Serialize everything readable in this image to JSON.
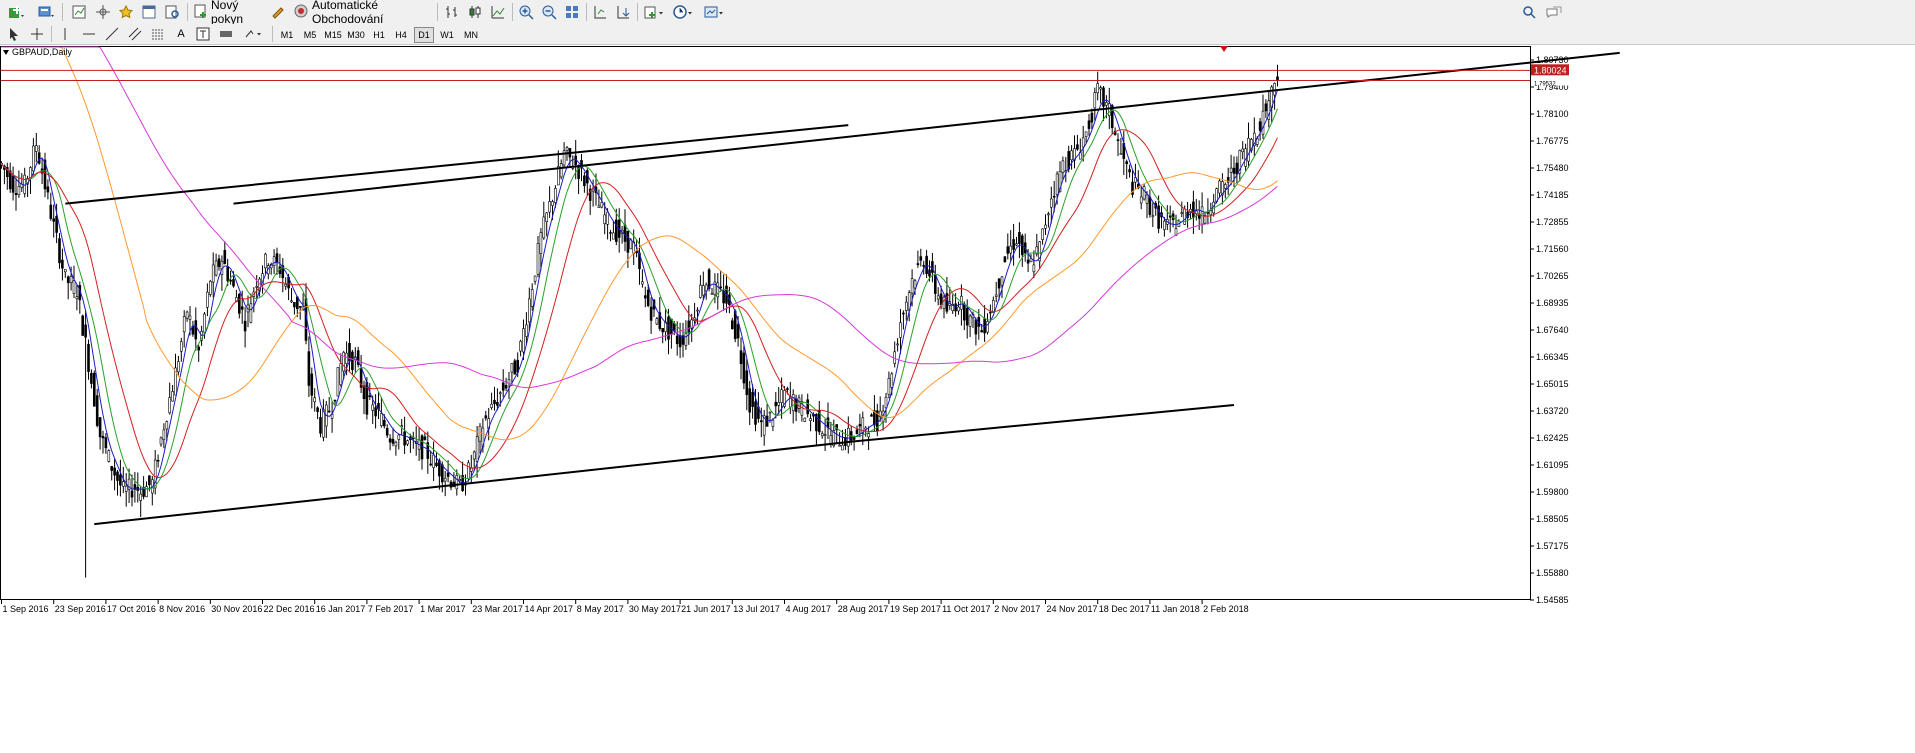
{
  "toolbar": {
    "new_order_label": "Nový pokyn",
    "auto_trading_label": "Automatické Obchodování",
    "icons": [
      "new-chart-icon",
      "profiles-icon",
      "market-watch-icon",
      "navigator-icon",
      "favorites-icon",
      "terminal-icon",
      "strategy-tester-icon",
      "new-order-icon",
      "metaeditor-icon",
      "auto-trading-icon",
      "bar-chart-icon",
      "candlestick-icon",
      "line-chart-icon",
      "zoom-in-icon",
      "zoom-out-icon",
      "tile-windows-icon",
      "chart-shift-icon",
      "autoscroll-icon",
      "indicators-icon",
      "periods-icon",
      "templates-icon",
      "search-icon",
      "chat-icon"
    ]
  },
  "timeframes": [
    "M1",
    "M5",
    "M15",
    "M30",
    "H1",
    "H4",
    "D1",
    "W1",
    "MN"
  ],
  "active_timeframe": "D1",
  "chart_data": {
    "type": "candlestick",
    "title": "GBPAUD,Daily",
    "symbol": "GBPAUD",
    "period": "Daily",
    "price_ticks": [
      "1.80730",
      "1.79400",
      "1.78100",
      "1.76775",
      "1.75480",
      "1.74185",
      "1.72855",
      "1.71560",
      "1.70265",
      "1.68935",
      "1.67640",
      "1.66345",
      "1.65015",
      "1.63720",
      "1.62425",
      "1.61095",
      "1.59800",
      "1.58505",
      "1.57175",
      "1.55880",
      "1.54585"
    ],
    "ylim": [
      1.54585,
      1.8114
    ],
    "date_ticks": [
      "1 Sep 2016",
      "23 Sep 2016",
      "17 Oct 2016",
      "8 Nov 2016",
      "30 Nov 2016",
      "22 Dec 2016",
      "16 Jan 2017",
      "7 Feb 2017",
      "1 Mar 2017",
      "23 Mar 2017",
      "14 Apr 2017",
      "8 May 2017",
      "30 May 2017",
      "21 Jun 2017",
      "13 Jul 2017",
      "4 Aug 2017",
      "28 Aug 2017",
      "19 Sep 2017",
      "11 Oct 2017",
      "2 Nov 2017",
      "24 Nov 2017",
      "18 Dec 2017",
      "11 Jan 2018",
      "2 Feb 2018"
    ],
    "current_price_label": "1.80024",
    "secondary_price_label": "1.79532",
    "horizontal_lines": [
      1.8002,
      1.7953
    ],
    "close_path": [
      [
        0,
        1.755
      ],
      [
        4,
        1.745
      ],
      [
        8,
        1.745
      ],
      [
        12,
        1.765
      ],
      [
        15,
        1.745
      ],
      [
        18,
        1.725
      ],
      [
        22,
        1.7
      ],
      [
        26,
        1.695
      ],
      [
        30,
        1.66
      ],
      [
        34,
        1.625
      ],
      [
        38,
        1.61
      ],
      [
        42,
        1.598
      ],
      [
        46,
        1.6
      ],
      [
        48,
        1.598
      ],
      [
        52,
        1.602
      ],
      [
        56,
        1.63
      ],
      [
        60,
        1.655
      ],
      [
        64,
        1.685
      ],
      [
        68,
        1.665
      ],
      [
        72,
        1.7
      ],
      [
        76,
        1.71
      ],
      [
        80,
        1.695
      ],
      [
        84,
        1.68
      ],
      [
        88,
        1.7
      ],
      [
        92,
        1.71
      ],
      [
        96,
        1.705
      ],
      [
        100,
        1.69
      ],
      [
        104,
        1.685
      ],
      [
        106,
        1.65
      ],
      [
        110,
        1.63
      ],
      [
        114,
        1.64
      ],
      [
        118,
        1.665
      ],
      [
        122,
        1.66
      ],
      [
        126,
        1.64
      ],
      [
        130,
        1.635
      ],
      [
        134,
        1.625
      ],
      [
        138,
        1.625
      ],
      [
        142,
        1.62
      ],
      [
        146,
        1.618
      ],
      [
        150,
        1.61
      ],
      [
        154,
        1.605
      ],
      [
        158,
        1.6
      ],
      [
        162,
        1.61
      ],
      [
        166,
        1.63
      ],
      [
        170,
        1.64
      ],
      [
        174,
        1.65
      ],
      [
        178,
        1.66
      ],
      [
        182,
        1.69
      ],
      [
        186,
        1.72
      ],
      [
        190,
        1.74
      ],
      [
        194,
        1.76
      ],
      [
        198,
        1.755
      ],
      [
        202,
        1.745
      ],
      [
        206,
        1.735
      ],
      [
        210,
        1.725
      ],
      [
        214,
        1.72
      ],
      [
        218,
        1.715
      ],
      [
        222,
        1.69
      ],
      [
        226,
        1.68
      ],
      [
        230,
        1.675
      ],
      [
        234,
        1.67
      ],
      [
        238,
        1.68
      ],
      [
        242,
        1.7
      ],
      [
        246,
        1.695
      ],
      [
        250,
        1.69
      ],
      [
        254,
        1.67
      ],
      [
        258,
        1.64
      ],
      [
        262,
        1.63
      ],
      [
        266,
        1.635
      ],
      [
        270,
        1.645
      ],
      [
        274,
        1.64
      ],
      [
        278,
        1.635
      ],
      [
        282,
        1.63
      ],
      [
        286,
        1.625
      ],
      [
        290,
        1.623
      ],
      [
        294,
        1.625
      ],
      [
        298,
        1.63
      ],
      [
        302,
        1.632
      ],
      [
        306,
        1.65
      ],
      [
        310,
        1.68
      ],
      [
        314,
        1.7
      ],
      [
        318,
        1.71
      ],
      [
        322,
        1.695
      ],
      [
        326,
        1.685
      ],
      [
        330,
        1.69
      ],
      [
        334,
        1.68
      ],
      [
        338,
        1.675
      ],
      [
        342,
        1.69
      ],
      [
        346,
        1.71
      ],
      [
        350,
        1.72
      ],
      [
        354,
        1.705
      ],
      [
        358,
        1.715
      ],
      [
        362,
        1.74
      ],
      [
        366,
        1.755
      ],
      [
        370,
        1.76
      ],
      [
        374,
        1.77
      ],
      [
        378,
        1.79
      ],
      [
        382,
        1.78
      ],
      [
        386,
        1.76
      ],
      [
        390,
        1.745
      ],
      [
        394,
        1.74
      ],
      [
        398,
        1.73
      ],
      [
        402,
        1.725
      ],
      [
        406,
        1.728
      ],
      [
        410,
        1.735
      ],
      [
        414,
        1.73
      ],
      [
        418,
        1.74
      ],
      [
        422,
        1.745
      ],
      [
        426,
        1.755
      ],
      [
        430,
        1.765
      ],
      [
        434,
        1.775
      ],
      [
        438,
        1.79
      ],
      [
        440,
        1.8002
      ]
    ],
    "trendlines": [
      {
        "name": "upper-channel",
        "from": [
          80,
          1.7362
        ],
        "to": [
          558,
          1.8086
        ]
      },
      {
        "name": "upper-channel-short",
        "from": [
          22,
          1.7362
        ],
        "to": [
          292,
          1.7739
        ]
      },
      {
        "name": "lower-channel",
        "from": [
          32,
          1.5823
        ],
        "to": [
          294,
          1.622
        ]
      },
      {
        "name": "lower-channel-extension",
        "from": [
          294,
          1.622
        ],
        "to": [
          425,
          1.6395
        ]
      }
    ],
    "moving_averages": [
      {
        "color": "#1c1cc8"
      },
      {
        "color": "#2aa02a"
      },
      {
        "color": "#d42020"
      },
      {
        "color": "#ff9a2e"
      },
      {
        "color": "#d83ad8"
      }
    ],
    "grid": false
  }
}
